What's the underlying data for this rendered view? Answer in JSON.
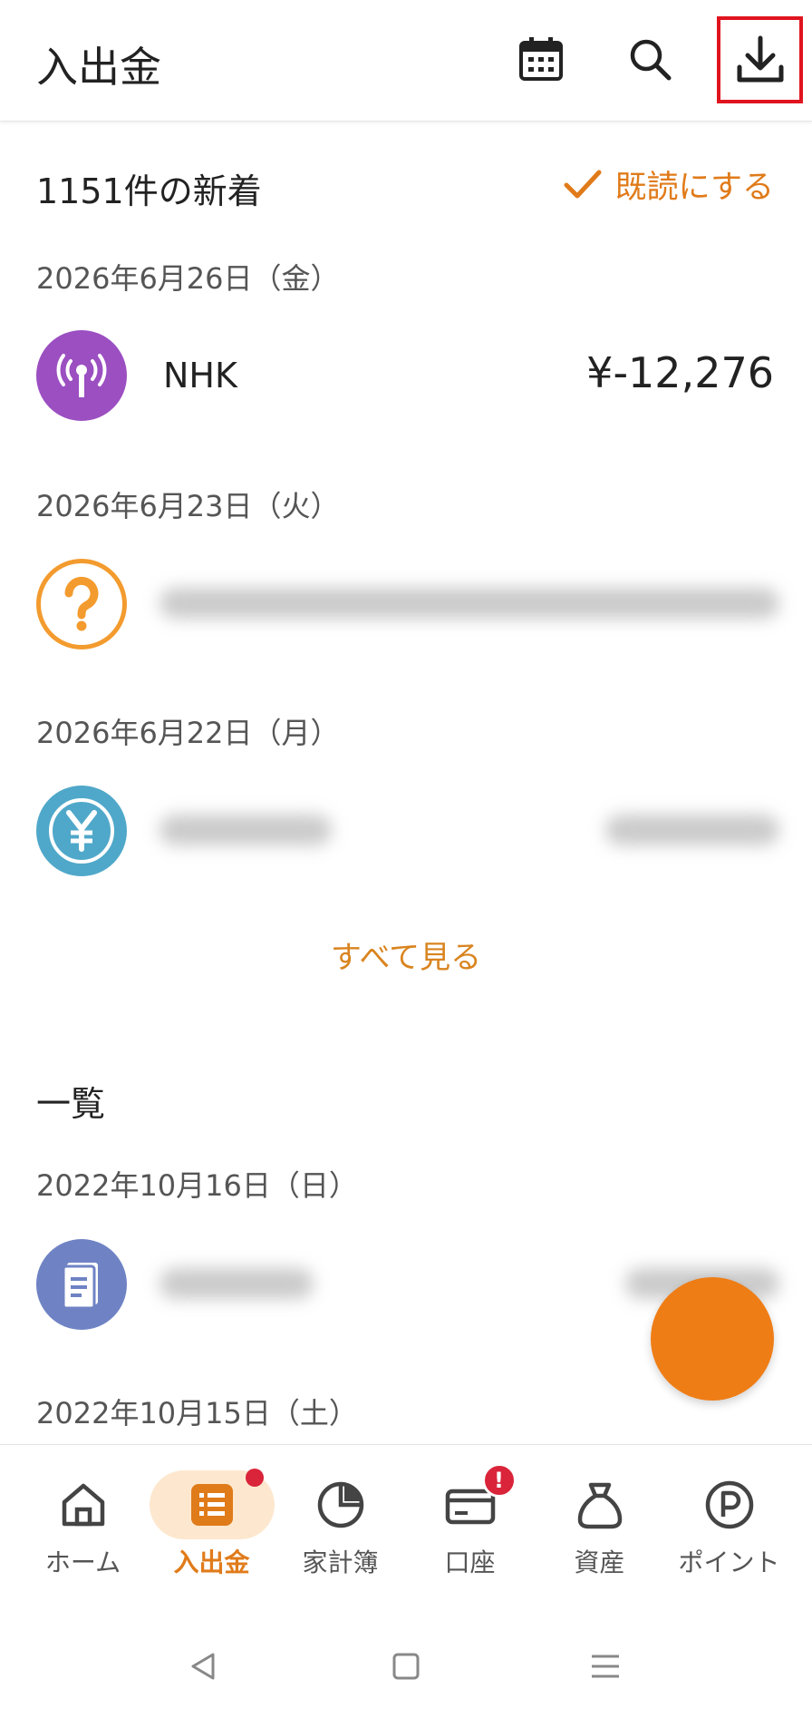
{
  "header": {
    "title": "入出金",
    "icons": [
      "calendar-icon",
      "search-icon",
      "download-icon"
    ]
  },
  "new_section": {
    "heading": "1151件の新着",
    "mark_read_label": "既読にする",
    "groups": [
      {
        "date": "2026年6月26日（金）",
        "item": {
          "name": "NHK",
          "amount": "¥-12,276",
          "icon": "broadcast-icon",
          "color": "#9b4fc1"
        }
      },
      {
        "date": "2026年6月23日（火）",
        "item": {
          "icon": "question-icon",
          "color": "#f39b2e"
        }
      },
      {
        "date": "2026年6月22日（月）",
        "item": {
          "icon": "yen-icon",
          "color": "#4fa8c9"
        }
      }
    ],
    "see_all_label": "すべて見る"
  },
  "list_section": {
    "heading": "一覧",
    "groups": [
      {
        "date": "2022年10月16日（日）",
        "item": {
          "icon": "book-icon",
          "color": "#6f83c4"
        }
      },
      {
        "date": "2022年10月15日（土）"
      }
    ]
  },
  "bottom_nav": {
    "items": [
      {
        "label": "ホーム",
        "icon": "home-icon"
      },
      {
        "label": "入出金",
        "icon": "list-icon",
        "active": true
      },
      {
        "label": "家計簿",
        "icon": "pie-chart-icon"
      },
      {
        "label": "口座",
        "icon": "card-icon",
        "badge": "!"
      },
      {
        "label": "資産",
        "icon": "money-bag-icon"
      },
      {
        "label": "ポイント",
        "icon": "points-icon"
      }
    ]
  },
  "colors": {
    "accent": "#e07b1a",
    "fab": "#ef7d16",
    "badge": "#d9243a"
  }
}
